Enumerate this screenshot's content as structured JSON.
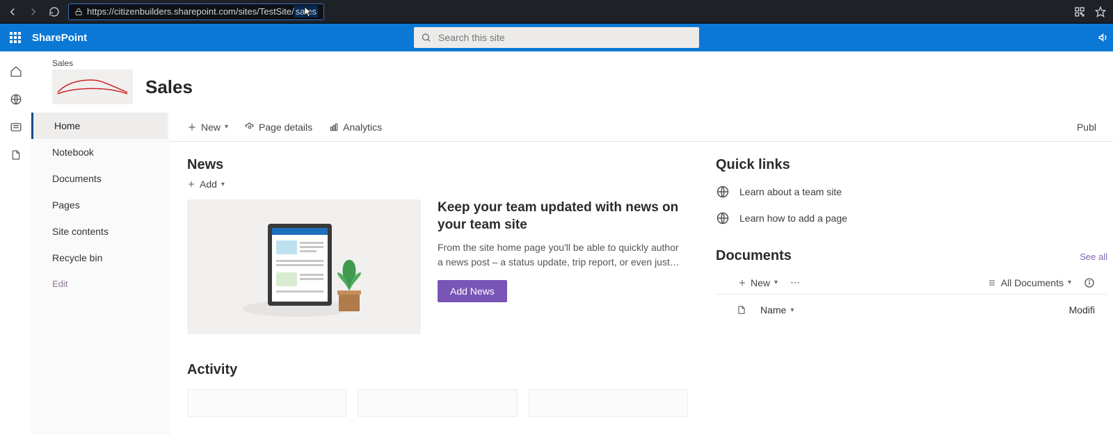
{
  "browser": {
    "url_prefix": "https://citizenbuilders.sharepoint.com/sites/TestSite/",
    "url_highlight": "sales"
  },
  "header": {
    "brand": "SharePoint",
    "search_placeholder": "Search this site"
  },
  "site": {
    "crumb": "Sales",
    "title": "Sales"
  },
  "nav": {
    "items": [
      "Home",
      "Notebook",
      "Documents",
      "Pages",
      "Site contents",
      "Recycle bin"
    ],
    "edit": "Edit"
  },
  "cmd": {
    "new": "New",
    "page_details": "Page details",
    "analytics": "Analytics",
    "publish": "Publ"
  },
  "news": {
    "title": "News",
    "add": "Add",
    "headline": "Keep your team updated with news on your team site",
    "body": "From the site home page you'll be able to quickly author a news post – a status update, trip report, or even just…",
    "button": "Add News"
  },
  "activity": {
    "title": "Activity"
  },
  "quicklinks": {
    "title": "Quick links",
    "items": [
      "Learn about a team site",
      "Learn how to add a page"
    ]
  },
  "documents": {
    "title": "Documents",
    "see_all": "See all",
    "new": "New",
    "view": "All Documents",
    "col_name": "Name",
    "col_modified": "Modifi"
  }
}
